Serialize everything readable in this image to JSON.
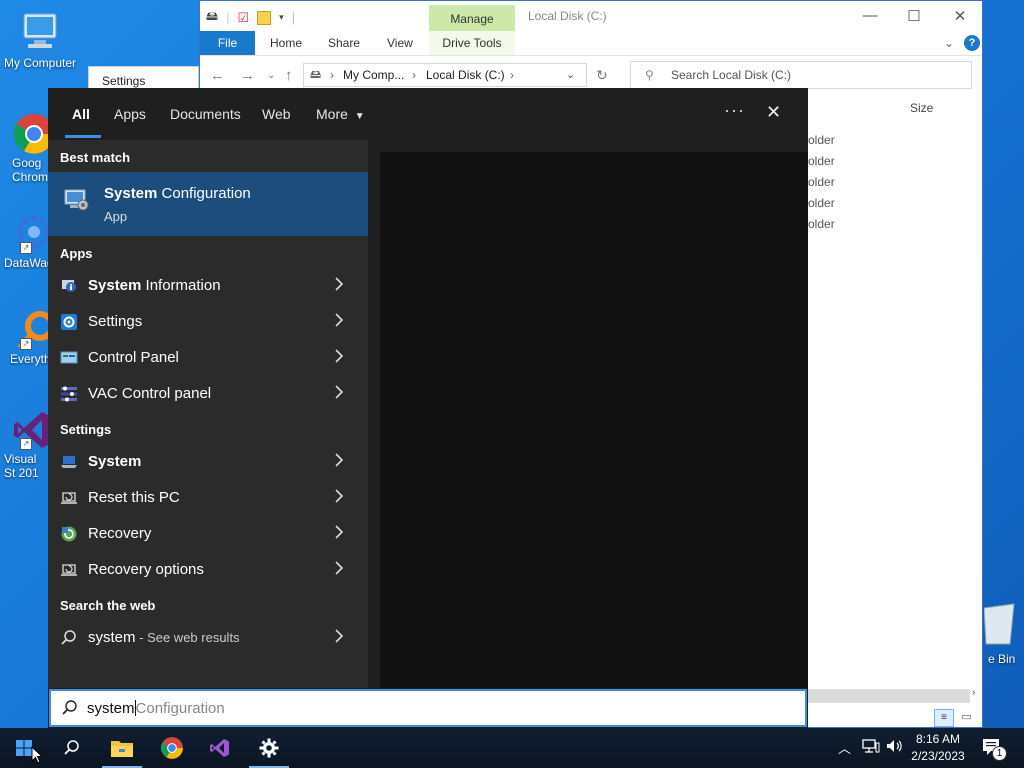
{
  "desktop": {
    "icons": [
      {
        "label": "My Computer",
        "icon": "monitor-icon"
      },
      {
        "label": "Goog Chrom",
        "icon": "chrome-icon"
      },
      {
        "label": "DataWag",
        "icon": "datawag-icon"
      },
      {
        "label": "Everyth",
        "icon": "everything-icon"
      },
      {
        "label": "Visual St 201",
        "icon": "visual-studio-icon"
      }
    ],
    "recycle_bin_label": "e Bin",
    "settings_window_title": "Settings"
  },
  "explorer": {
    "title": "Local Disk (C:)",
    "manage_tab": "Manage",
    "ribbon_tabs": [
      "File",
      "Home",
      "Share",
      "View",
      "Drive Tools"
    ],
    "breadcrumb": [
      "My Comp...",
      "Local Disk (C:)"
    ],
    "search_placeholder": "Search Local Disk (C:)",
    "column_size": "Size",
    "items": [
      "older",
      "older",
      "older",
      "older",
      "older"
    ]
  },
  "search_panel": {
    "tabs": [
      "All",
      "Apps",
      "Documents",
      "Web",
      "More"
    ],
    "active_tab": "All",
    "best_match_header": "Best match",
    "best_match": {
      "bold": "System",
      "rest": " Configuration",
      "subtitle": "App",
      "icon": "system-configuration-icon"
    },
    "apps_header": "Apps",
    "apps": [
      {
        "bold": "System",
        "rest": " Information",
        "icon": "system-information-icon"
      },
      {
        "bold": "",
        "rest": "Settings",
        "icon": "settings-gear-icon"
      },
      {
        "bold": "",
        "rest": "Control Panel",
        "icon": "control-panel-icon"
      },
      {
        "bold": "",
        "rest": "VAC Control panel",
        "icon": "vac-control-panel-icon"
      }
    ],
    "settings_header": "Settings",
    "settings": [
      {
        "bold": "System",
        "rest": "",
        "icon": "system-laptop-icon"
      },
      {
        "bold": "",
        "rest": "Reset this PC",
        "icon": "reset-pc-icon"
      },
      {
        "bold": "",
        "rest": "Recovery",
        "icon": "recovery-icon"
      },
      {
        "bold": "",
        "rest": "Recovery options",
        "icon": "recovery-options-icon"
      }
    ],
    "web_header": "Search the web",
    "web": {
      "query": "system",
      "hint": " - See web results"
    },
    "search_query": "system",
    "search_suggestion": "Configuration"
  },
  "taskbar": {
    "time": "8:16 AM",
    "date": "2/23/2023",
    "notification_count": "1",
    "apps": [
      "start-icon",
      "search-icon",
      "file-explorer-icon",
      "chrome-icon",
      "visual-studio-icon",
      "settings-gear-icon"
    ]
  },
  "colors": {
    "accent": "#3a8ee6",
    "best_match_bg": "#1d4d7c",
    "panel_bg": "#2b2b2b"
  }
}
